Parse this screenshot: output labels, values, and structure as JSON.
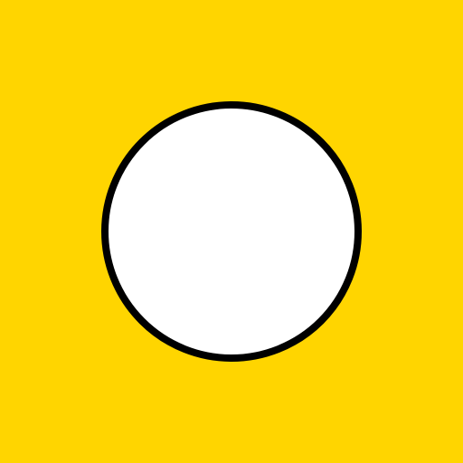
{
  "colors": {
    "background": "#FFD500",
    "circle_fill": "#FFFFFF",
    "circle_stroke": "#000000"
  },
  "shapes": [
    {
      "type": "circle",
      "name": "white-circle",
      "fill": "white",
      "outline": "black"
    }
  ]
}
